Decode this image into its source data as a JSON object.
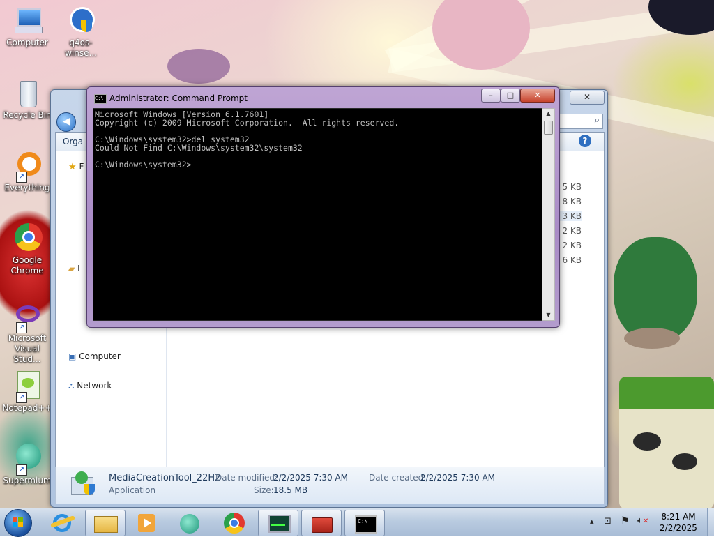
{
  "desktop": {
    "icons": [
      {
        "label": "Computer",
        "icon": "computer-icon"
      },
      {
        "label": "q4os-winse...",
        "icon": "shield-installer-icon"
      },
      {
        "label": "Recycle Bin",
        "icon": "recycle-bin-icon"
      },
      {
        "label": "Everything",
        "icon": "everything-search-icon"
      },
      {
        "label": "Google Chrome",
        "icon": "chrome-icon"
      },
      {
        "label": "Microsoft Visual Stud...",
        "icon": "visual-studio-icon"
      },
      {
        "label": "Notepad++",
        "icon": "notepadpp-icon"
      },
      {
        "label": "Supermium",
        "icon": "supermium-icon"
      }
    ]
  },
  "explorer": {
    "organize_label": "Orga",
    "nav": {
      "favorites_partial": "F",
      "libraries_partial": "L",
      "computer": "Computer",
      "network": "Network"
    },
    "sizes": [
      "5 KB",
      "8 KB",
      "3 KB",
      "2 KB",
      "2 KB",
      "6 KB"
    ],
    "details": {
      "name": "MediaCreationTool_22H2",
      "type": "Application",
      "date_modified_label": "Date modified:",
      "date_modified": "2/2/2025 7:30 AM",
      "date_created_label": "Date created:",
      "date_created": "2/2/2025 7:30 AM",
      "size_label": "Size:",
      "size": "18.5 MB"
    }
  },
  "cmd": {
    "title": "Administrator: Command Prompt",
    "icon_text": "C:\\",
    "console_lines": [
      "Microsoft Windows [Version 6.1.7601]",
      "Copyright (c) 2009 Microsoft Corporation.  All rights reserved.",
      "",
      "C:\\Windows\\system32>del system32",
      "Could Not Find C:\\Windows\\system32\\system32",
      "",
      "C:\\Windows\\system32>"
    ],
    "min_glyph": "–",
    "max_glyph": "□",
    "close_glyph": "✕"
  },
  "taskbar": {
    "start_icon": "windows-start-icon",
    "pinned": [
      "internet-explorer-icon",
      "file-explorer-icon",
      "media-player-icon",
      "supermium-icon",
      "chrome-icon",
      "task-manager-icon",
      "toolbox-icon",
      "command-prompt-icon"
    ],
    "tray": {
      "show_hidden_glyph": "▴",
      "time": "8:21 AM",
      "date": "2/2/2025"
    }
  }
}
